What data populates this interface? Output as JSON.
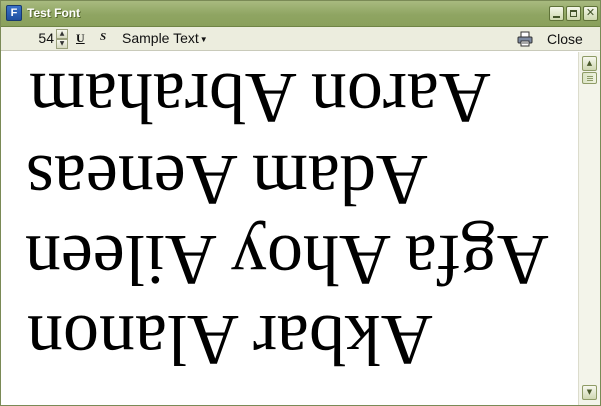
{
  "window": {
    "title": "Test Font",
    "app_icon_letter": "F"
  },
  "toolbar": {
    "font_size": "54",
    "underline_label": "U",
    "strike_label": "S",
    "sample_label": "Sample Text",
    "close_label": "Close"
  },
  "preview": {
    "lines": [
      "Aaron Abraham",
      "Adam Aeneas",
      "Agfa Ahoy Aileen",
      "Akbar Alanon"
    ]
  },
  "icons": {
    "app": "font-app-icon",
    "print": "printer-icon",
    "dropdown": "caret-down-icon"
  }
}
